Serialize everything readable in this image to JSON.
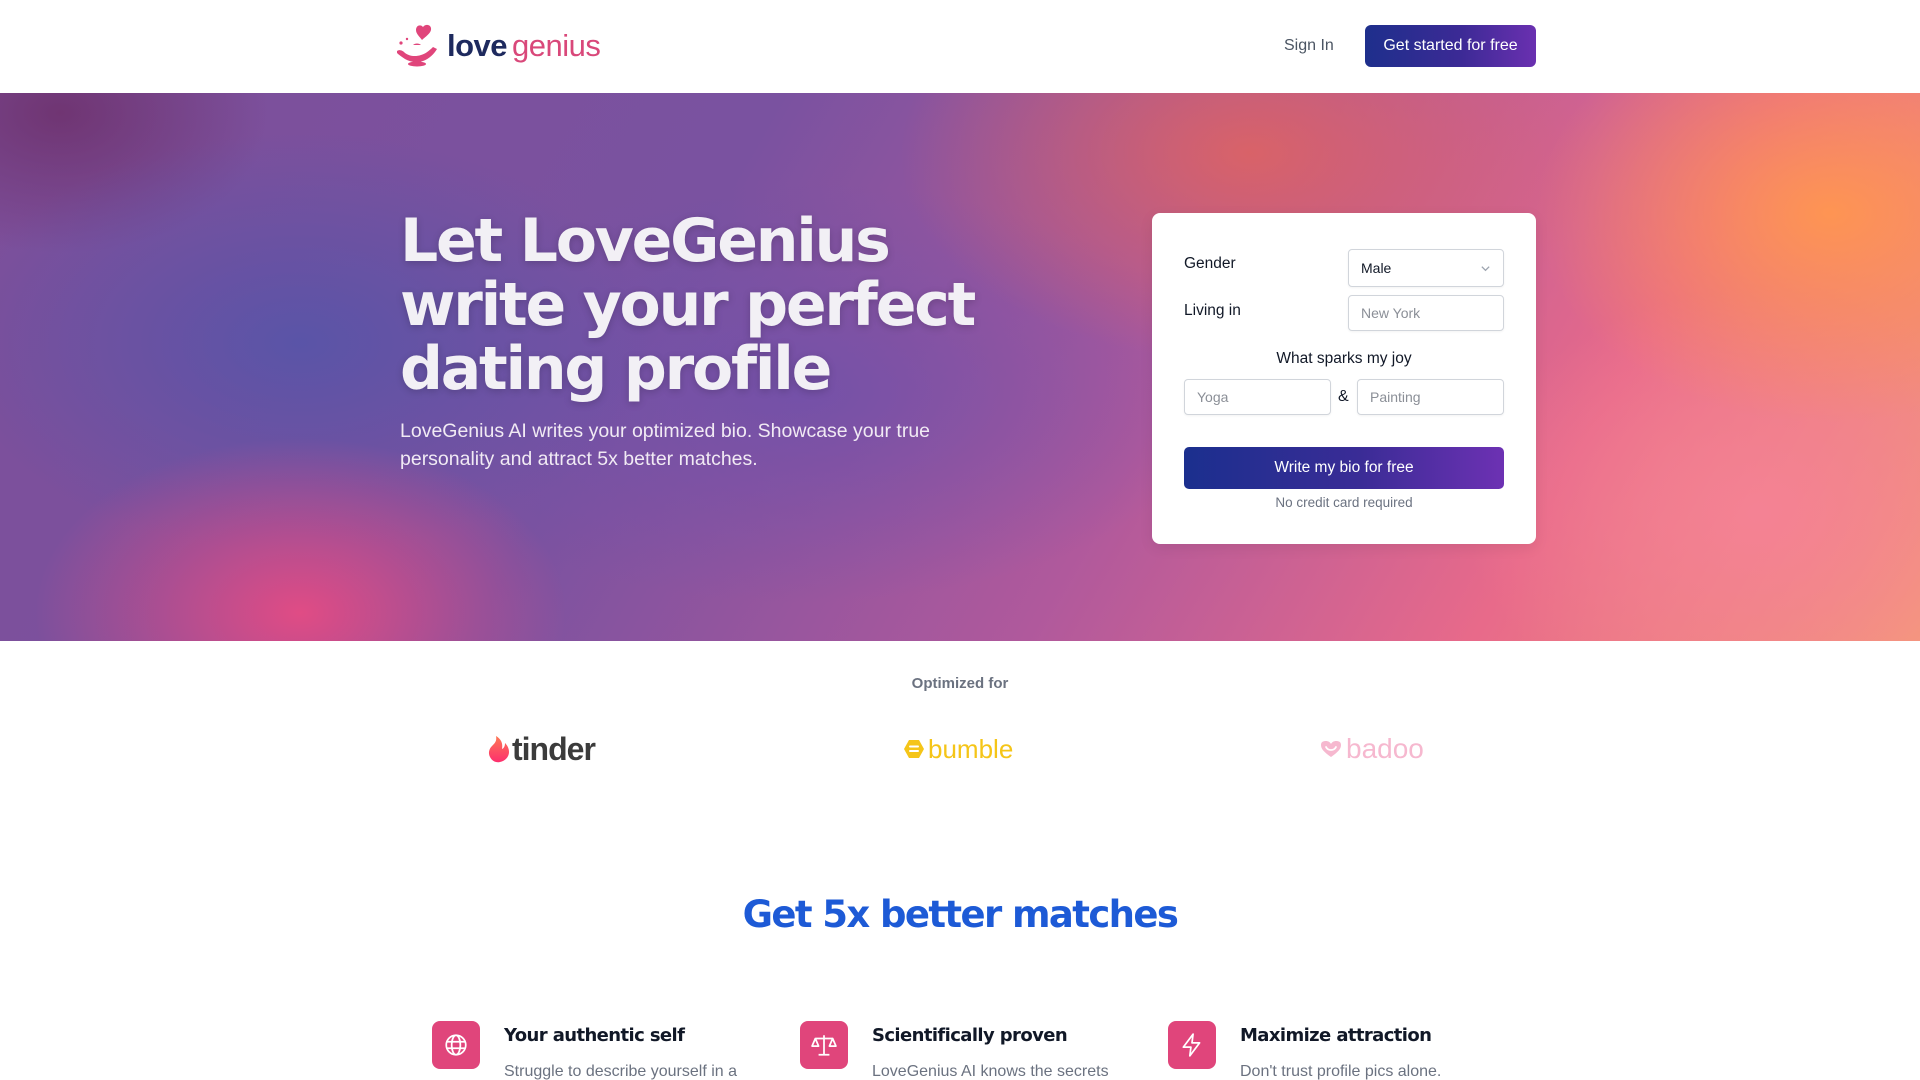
{
  "nav": {
    "logo_part1": "love",
    "logo_part2": "genius",
    "logo_icon": "genie-lamp-heart-icon",
    "sign_in": "Sign In",
    "cta": "Get started for free"
  },
  "hero": {
    "title": "Let LoveGenius write your perfect dating profile",
    "subtitle": "LoveGenius AI writes your optimized bio. Showcase your true personality and attract 5x better matches."
  },
  "form": {
    "gender_label": "Gender",
    "gender_value": "Male",
    "living_label": "Living in",
    "living_placeholder": "New York",
    "joy_label": "What sparks my joy",
    "joy1_placeholder": "Yoga",
    "joy_separator": "&",
    "joy2_placeholder": "Painting",
    "submit": "Write my bio for free",
    "note": "No credit card required"
  },
  "optimized": {
    "label": "Optimized for",
    "brands": [
      {
        "name": "tinder",
        "icon": "flame-icon",
        "color": "#fd5068"
      },
      {
        "name": "bumble",
        "icon": "hexagon-icon",
        "color": "#f5c518"
      },
      {
        "name": "badoo",
        "icon": "heart-icon",
        "color": "#f6b8cf"
      }
    ]
  },
  "features": {
    "title": "Get 5x better matches",
    "items": [
      {
        "icon": "globe-icon",
        "title": "Your authentic self",
        "desc": "Struggle to describe yourself in a"
      },
      {
        "icon": "scale-icon",
        "title": "Scientifically proven",
        "desc": "LoveGenius AI knows the secrets"
      },
      {
        "icon": "lightning-icon",
        "title": "Maximize attraction",
        "desc": "Don't trust profile pics alone."
      }
    ]
  },
  "colors": {
    "brand_navy": "#1e2a5e",
    "brand_pink": "#d9487a",
    "cta_gradient_start": "#1e2f8c",
    "cta_gradient_end": "#6a30b0",
    "section_title_blue": "#1d5ad6",
    "feature_icon_bg": "#e0457b"
  }
}
